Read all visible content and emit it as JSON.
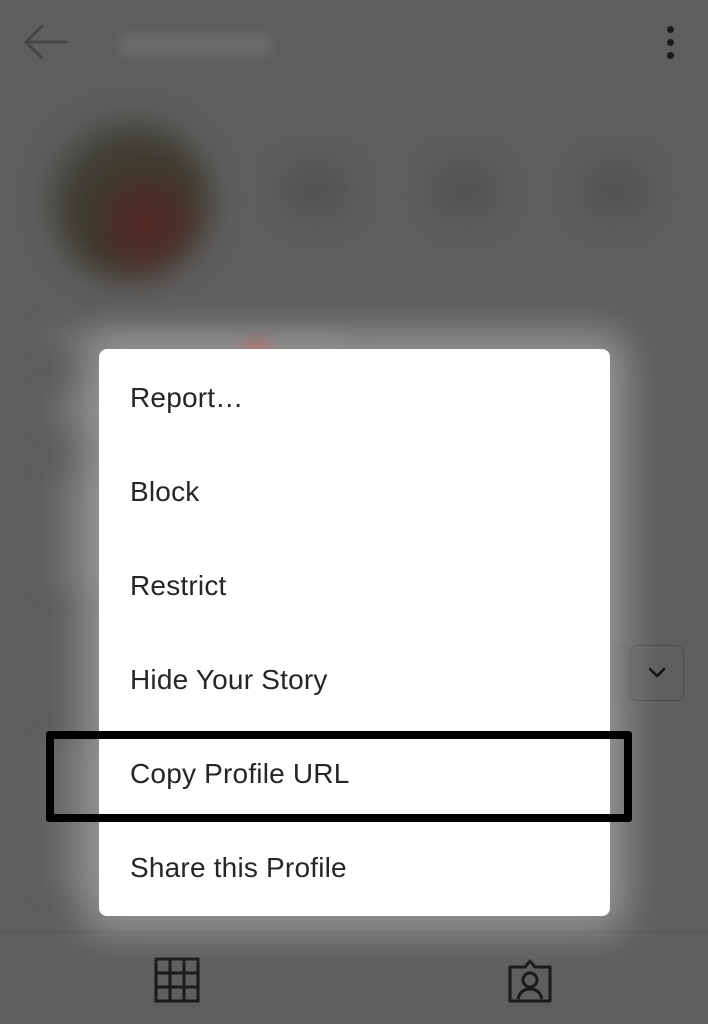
{
  "menu": {
    "items": [
      {
        "label": "Report…"
      },
      {
        "label": "Block"
      },
      {
        "label": "Restrict"
      },
      {
        "label": "Hide Your Story"
      },
      {
        "label": "Copy Profile URL"
      },
      {
        "label": "Share this Profile"
      }
    ],
    "highlighted_item": "Copy Profile URL"
  },
  "icons": {
    "back": "arrow-left-icon",
    "more": "more-vertical-icon",
    "chevron": "chevron-down-icon",
    "grid": "grid-icon",
    "tagged": "tagged-photos-icon"
  },
  "colors": {
    "overlay": "#5e5e5e",
    "menu_background": "#ffffff",
    "menu_text": "#262626",
    "highlight_border": "#000000"
  }
}
